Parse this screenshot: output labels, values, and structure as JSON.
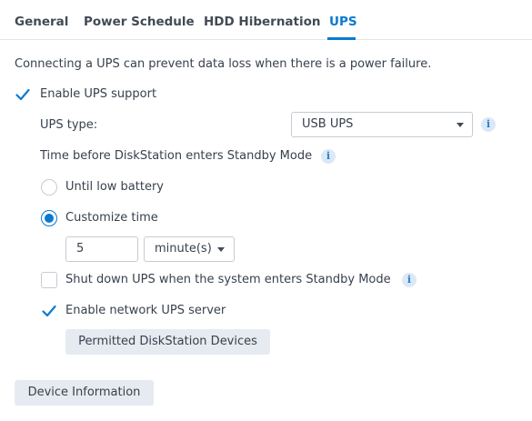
{
  "tabs": {
    "general": "General",
    "power_schedule": "Power Schedule",
    "hdd_hibernation": "HDD Hibernation",
    "ups": "UPS",
    "active": "UPS"
  },
  "ups": {
    "description": "Connecting a UPS can prevent data loss when there is a power failure.",
    "enable_label": "Enable UPS support",
    "enable_checked": true,
    "type_label": "UPS type:",
    "type_value": "USB UPS",
    "standby_label": "Time before DiskStation enters Standby Mode",
    "until_low_battery_label": "Until low battery",
    "until_low_battery_selected": false,
    "customize_time_label": "Customize time",
    "customize_time_selected": true,
    "time_value": "5",
    "time_unit": "minute(s)",
    "shutdown_label": "Shut down UPS when the system enters Standby Mode",
    "shutdown_checked": false,
    "network_server_label": "Enable network UPS server",
    "network_server_checked": true,
    "permitted_button": "Permitted DiskStation Devices",
    "device_info_button": "Device Information"
  },
  "colors": {
    "accent": "#0a7ad1",
    "text": "#37414d",
    "button_bg": "#e6ebf1"
  },
  "icons": {
    "info": "i",
    "check": "checkmark-icon",
    "dropdown": "chevron-down-icon"
  }
}
